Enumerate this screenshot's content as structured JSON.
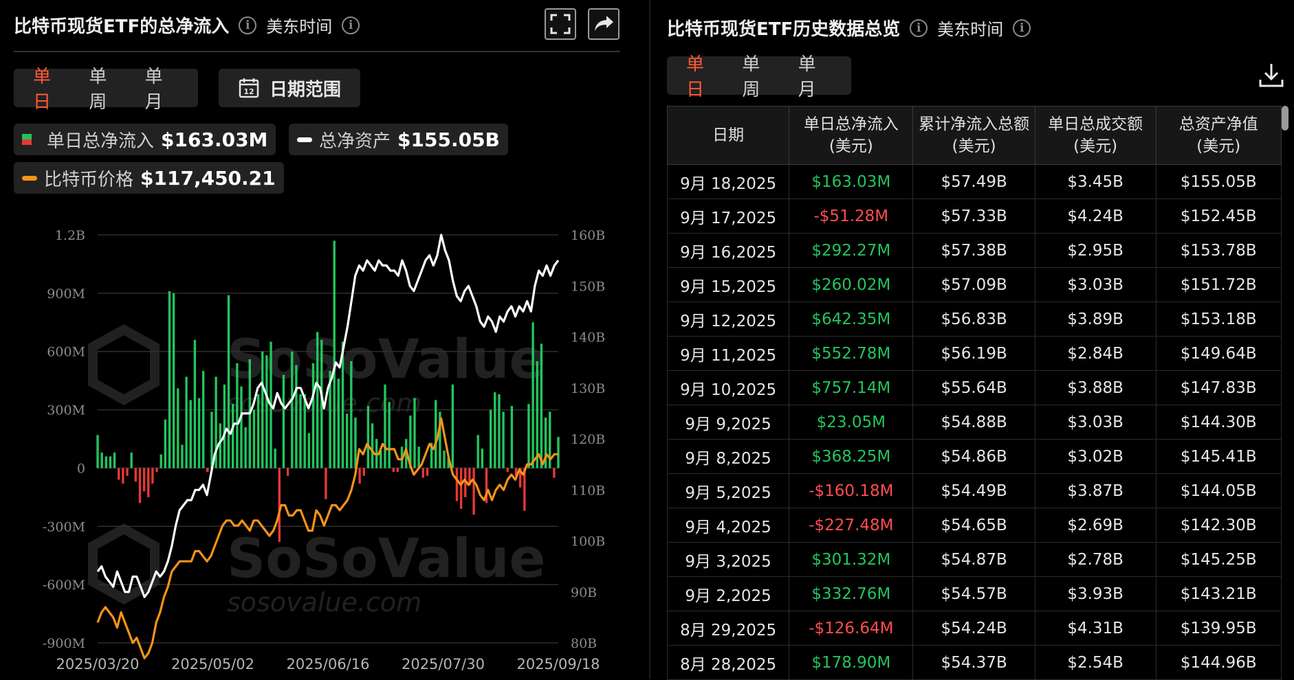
{
  "left": {
    "title": "比特币现货ETF的总净流入",
    "timezone": "美东时间",
    "tabs": [
      "单日",
      "单周",
      "单月"
    ],
    "active_tab": 0,
    "date_range_label": "日期范围",
    "calendar_day": "12",
    "legend": [
      {
        "label": "单日总净流入",
        "value": "$163.03M"
      },
      {
        "label": "总净资产",
        "value": "$155.05B",
        "color": "#ffffff"
      },
      {
        "label": "比特币价格",
        "value": "$117,450.21",
        "color": "#f7931a"
      }
    ],
    "watermark": {
      "brand": "SoSoValue",
      "site": "sosovalue.com"
    }
  },
  "right": {
    "title": "比特币现货ETF历史数据总览",
    "timezone": "美东时间",
    "tabs": [
      "单日",
      "单周",
      "单月"
    ],
    "active_tab": 0,
    "columns": [
      "日期",
      "单日总净流入(美元)",
      "累计净流入总额(美元)",
      "单日总成交额(美元)",
      "总资产净值(美元)"
    ],
    "rows": [
      [
        "9月 18,2025",
        "$163.03M",
        "$57.49B",
        "$3.45B",
        "$155.05B"
      ],
      [
        "9月 17,2025",
        "-$51.28M",
        "$57.33B",
        "$4.24B",
        "$152.45B"
      ],
      [
        "9月 16,2025",
        "$292.27M",
        "$57.38B",
        "$2.95B",
        "$153.78B"
      ],
      [
        "9月 15,2025",
        "$260.02M",
        "$57.09B",
        "$3.03B",
        "$151.72B"
      ],
      [
        "9月 12,2025",
        "$642.35M",
        "$56.83B",
        "$3.89B",
        "$153.18B"
      ],
      [
        "9月 11,2025",
        "$552.78M",
        "$56.19B",
        "$2.84B",
        "$149.64B"
      ],
      [
        "9月 10,2025",
        "$757.14M",
        "$55.64B",
        "$3.88B",
        "$147.83B"
      ],
      [
        "9月 9,2025",
        "$23.05M",
        "$54.88B",
        "$3.03B",
        "$144.30B"
      ],
      [
        "9月 8,2025",
        "$368.25M",
        "$54.86B",
        "$3.02B",
        "$145.41B"
      ],
      [
        "9月 5,2025",
        "-$160.18M",
        "$54.49B",
        "$3.87B",
        "$144.05B"
      ],
      [
        "9月 4,2025",
        "-$227.48M",
        "$54.65B",
        "$2.69B",
        "$142.30B"
      ],
      [
        "9月 3,2025",
        "$301.32M",
        "$54.87B",
        "$2.78B",
        "$145.25B"
      ],
      [
        "9月 2,2025",
        "$332.76M",
        "$54.57B",
        "$3.93B",
        "$143.21B"
      ],
      [
        "8月 29,2025",
        "-$126.64M",
        "$54.24B",
        "$4.31B",
        "$139.95B"
      ],
      [
        "8月 28,2025",
        "$178.90M",
        "$54.37B",
        "$2.54B",
        "$144.96B"
      ]
    ]
  },
  "chart_data": {
    "type": "bar",
    "x_ticks": [
      "2025/03/20",
      "2025/05/02",
      "2025/06/16",
      "2025/07/30",
      "2025/09/18"
    ],
    "y_left_ticks": [
      "1.2B",
      "900M",
      "600M",
      "300M",
      "0",
      "-300M",
      "-600M",
      "-900M"
    ],
    "y_left_range": [
      -900,
      1200
    ],
    "y_right_ticks": [
      "160B",
      "150B",
      "140B",
      "130B",
      "120B",
      "110B",
      "100B",
      "90B",
      "80B"
    ],
    "y_right_range": [
      80,
      160
    ],
    "series": [
      {
        "name": "单日总净流入",
        "type": "bar",
        "unit": "M USD",
        "values": [
          170,
          80,
          60,
          60,
          80,
          -60,
          -80,
          -40,
          80,
          -70,
          -180,
          -120,
          -150,
          -80,
          -20,
          70,
          250,
          910,
          900,
          410,
          120,
          470,
          350,
          660,
          360,
          500,
          -20,
          290,
          470,
          230,
          430,
          890,
          330,
          540,
          420,
          210,
          560,
          300,
          380,
          600,
          580,
          650,
          100,
          -380,
          480,
          -40,
          600,
          530,
          380,
          380,
          180,
          540,
          700,
          660,
          -160,
          500,
          1170,
          460,
          650,
          280,
          550,
          260,
          -80,
          -40,
          320,
          230,
          150,
          90,
          430,
          340,
          -20,
          -20,
          110,
          150,
          270,
          360,
          110,
          -50,
          -40,
          130,
          350,
          290,
          90,
          50,
          430,
          -170,
          -210,
          -150,
          -90,
          -240,
          170,
          100,
          -180,
          300,
          390,
          380,
          290,
          -20,
          320,
          -40,
          -100,
          -220,
          330,
          750,
          550,
          640,
          260,
          290,
          -50,
          160
        ],
        "color_positive": "#22c55e",
        "color_negative": "#e53935"
      },
      {
        "name": "总净资产",
        "type": "line",
        "axis": "right",
        "unit": "B USD",
        "color": "#ffffff",
        "values": [
          94,
          95,
          93,
          92,
          91,
          94,
          92,
          90,
          90,
          93,
          93,
          91,
          89,
          90,
          92,
          94,
          93,
          94,
          96,
          99,
          103,
          106,
          107,
          108,
          108,
          110,
          110,
          111,
          109,
          113,
          117,
          119,
          120,
          122,
          121,
          123,
          123,
          125,
          125,
          125,
          127,
          130,
          131,
          129,
          127,
          126,
          129,
          127,
          126,
          127,
          128,
          130,
          130,
          128,
          126,
          128,
          131,
          130,
          126,
          130,
          132,
          135,
          134,
          138,
          142,
          147,
          152,
          154,
          153,
          155,
          154,
          153,
          155,
          154,
          154,
          153,
          153,
          152,
          155,
          153,
          150,
          149,
          151,
          153,
          155,
          156,
          154,
          156,
          160,
          157,
          155,
          151,
          148,
          147,
          149,
          150,
          148,
          146,
          143,
          142,
          144,
          143,
          141,
          144,
          143,
          145,
          146,
          144,
          146,
          145,
          147,
          145,
          150,
          153,
          152,
          154,
          152,
          154,
          155
        ]
      },
      {
        "name": "比特币价格",
        "type": "line",
        "axis": "right",
        "unit": "k USD",
        "color": "#f7931a",
        "values": [
          84,
          86,
          87,
          86,
          85,
          83,
          86,
          84,
          82,
          80,
          81,
          79,
          77,
          78,
          80,
          84,
          86,
          89,
          91,
          94,
          95,
          96,
          96,
          96,
          96,
          98,
          98,
          97,
          96,
          97,
          99,
          101,
          103,
          104,
          104,
          103,
          103,
          104,
          103,
          102,
          104,
          104,
          103,
          102,
          101,
          102,
          104,
          107,
          107,
          105,
          105,
          106,
          106,
          104,
          102,
          102,
          106,
          105,
          103,
          105,
          107,
          107,
          106,
          107,
          108,
          110,
          113,
          118,
          117,
          119,
          118,
          117,
          117,
          119,
          118,
          118,
          118,
          116,
          116,
          118,
          115,
          113,
          114,
          115,
          117,
          119,
          118,
          120,
          124,
          120,
          116,
          113,
          112,
          111,
          112,
          111,
          112,
          111,
          109,
          108,
          110,
          108,
          110,
          111,
          110,
          112,
          113,
          112,
          114,
          113,
          115,
          115,
          116,
          117,
          115,
          117,
          116,
          117,
          117
        ]
      }
    ],
    "grid": true,
    "legend": "top-left"
  }
}
